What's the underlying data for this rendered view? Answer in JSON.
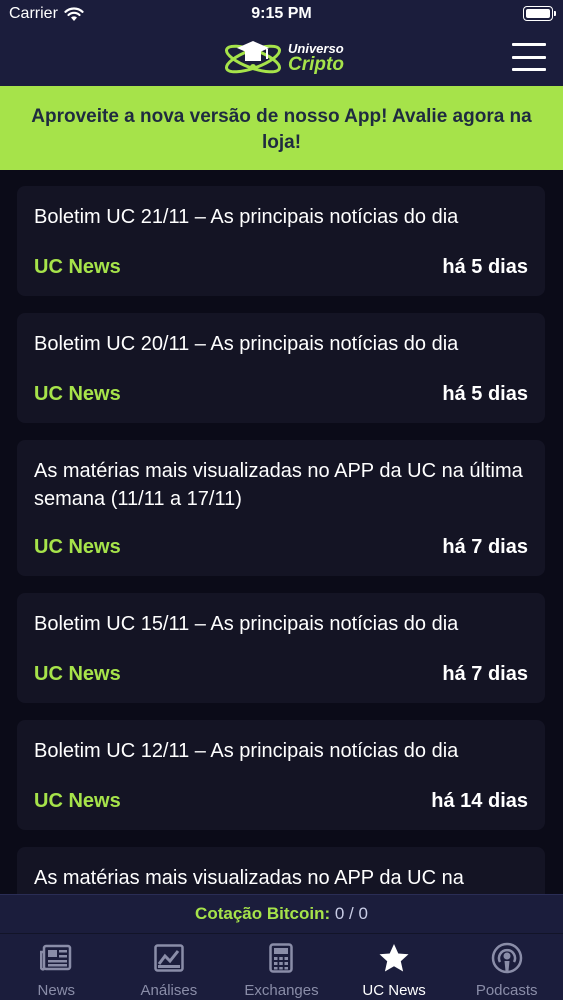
{
  "status_bar": {
    "carrier": "Carrier",
    "time": "9:15 PM"
  },
  "header": {
    "logo_line1": "Universo",
    "logo_line2": "Cripto",
    "menu_icon": "hamburger-menu-icon"
  },
  "promo": {
    "text": "Aproveite a nova versão de nosso App! Avalie agora na loja!"
  },
  "news": [
    {
      "title": "Boletim UC 21/11 – As principais notícias do dia",
      "source": "UC News",
      "age": "há 5 dias"
    },
    {
      "title": "Boletim UC 20/11 – As principais notícias do dia",
      "source": "UC News",
      "age": "há 5 dias"
    },
    {
      "title": "As matérias mais visualizadas no APP da UC na última semana (11/11 a 17/11)",
      "source": "UC News",
      "age": "há 7 dias"
    },
    {
      "title": "Boletim UC 15/11 – As principais notícias do dia",
      "source": "UC News",
      "age": "há 7 dias"
    },
    {
      "title": "Boletim UC 12/11 – As principais notícias do dia",
      "source": "UC News",
      "age": "há 14 dias"
    },
    {
      "title": "As matérias mais visualizadas no APP da UC na",
      "source": "",
      "age": ""
    }
  ],
  "bitcoin": {
    "label": "Cotação Bitcoin:",
    "value": "0 / 0"
  },
  "tabs": [
    {
      "label": "News",
      "icon": "newspaper-icon",
      "active": false
    },
    {
      "label": "Análises",
      "icon": "chart-icon",
      "active": false
    },
    {
      "label": "Exchanges",
      "icon": "calculator-icon",
      "active": false
    },
    {
      "label": "UC News",
      "icon": "star-icon",
      "active": true
    },
    {
      "label": "Podcasts",
      "icon": "podcast-icon",
      "active": false
    }
  ],
  "colors": {
    "accent": "#a6e34a",
    "header_bg": "#1b1d3c",
    "card_bg": "#141424",
    "page_bg": "#0b0b18"
  }
}
